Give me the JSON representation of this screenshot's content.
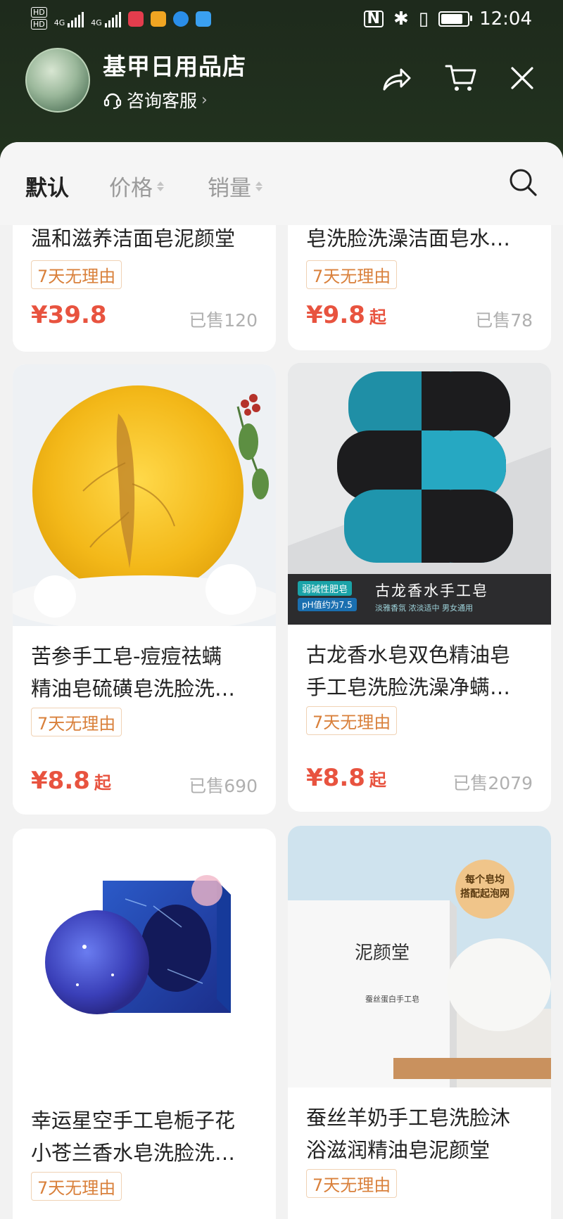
{
  "status_bar": {
    "time": "12:04",
    "network": [
      "4G",
      "4G"
    ]
  },
  "shop": {
    "name": "基甲日用品店",
    "consult": "咨询客服"
  },
  "sort": {
    "default": "默认",
    "price": "价格",
    "sales": "销量"
  },
  "products": [
    {
      "title": "温和滋养洁面皂泥颜堂",
      "tag": "7天无理由",
      "price": "¥39.8",
      "price_suffix": "",
      "sold": "已售120"
    },
    {
      "title": "皂洗脸洗澡洁面皂水…",
      "tag": "7天无理由",
      "price": "¥9.8",
      "price_suffix": "起",
      "sold": "已售78"
    },
    {
      "title_lines": [
        " 苦参手工皂-痘痘祛螨",
        "精油皂硫磺皂洗脸洗…"
      ],
      "tag": "7天无理由",
      "price": "¥8.8",
      "price_suffix": "起",
      "sold": "已售690"
    },
    {
      "title_lines": [
        "古龙香水皂双色精油皂",
        "手工皂洗脸洗澡净螨…"
      ],
      "tag": "7天无理由",
      "price": "¥8.8",
      "price_suffix": "起",
      "sold": "已售2079",
      "image_caption": {
        "badge": "弱碱性肥皂",
        "ph": "pH值约为7.5",
        "name": "古龙香水手工皂",
        "sub": "淡雅香氛 浓淡适中 男女通用"
      }
    },
    {
      "title_lines": [
        "幸运星空手工皂栀子花",
        "小苍兰香水皂洗脸洗…"
      ],
      "tag": "7天无理由"
    },
    {
      "title_lines": [
        "蚕丝羊奶手工皂洗脸沐",
        "浴滋润精油皂泥颜堂"
      ],
      "tag": "7天无理由",
      "image_caption": {
        "badge_l1": "每个皂均",
        "badge_l2": "搭配起泡网",
        "brand": "泥颜堂",
        "sub": "蚕丝蛋白手工皂"
      }
    }
  ],
  "colors": {
    "header": "#1e2a1c",
    "price": "#e8533f",
    "tag": "#d9803b"
  }
}
